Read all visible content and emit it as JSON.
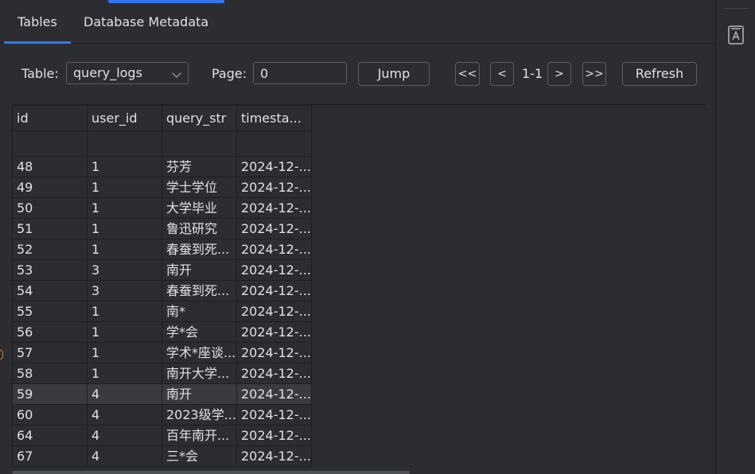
{
  "tabs": [
    {
      "label": "Tables",
      "active": true
    },
    {
      "label": "Database Metadata",
      "active": false
    }
  ],
  "toolbar": {
    "table_label": "Table:",
    "table_value": "query_logs",
    "page_label": "Page:",
    "page_value": "0",
    "jump_label": "Jump",
    "first_label": "<<",
    "prev_label": "<",
    "page_range": "1-1",
    "next_label": ">",
    "last_label": ">>",
    "refresh_label": "Refresh"
  },
  "table": {
    "columns": [
      "id",
      "user_id",
      "query_str",
      "timesta..."
    ],
    "rows": [
      [
        "48",
        "1",
        "芬芳",
        "2024-12-..."
      ],
      [
        "49",
        "1",
        "学士学位",
        "2024-12-..."
      ],
      [
        "50",
        "1",
        "大学毕业",
        "2024-12-..."
      ],
      [
        "51",
        "1",
        "鲁迅研究",
        "2024-12-..."
      ],
      [
        "52",
        "1",
        "春蚕到死...",
        "2024-12-..."
      ],
      [
        "53",
        "3",
        "南开",
        "2024-12-..."
      ],
      [
        "54",
        "3",
        "春蚕到死...",
        "2024-12-..."
      ],
      [
        "55",
        "1",
        "南*",
        "2024-12-..."
      ],
      [
        "56",
        "1",
        "学*会",
        "2024-12-..."
      ],
      [
        "57",
        "1",
        "学术*座谈...",
        "2024-12-..."
      ],
      [
        "58",
        "1",
        "南开大学...",
        "2024-12-..."
      ],
      [
        "59",
        "4",
        "南开",
        "2024-12-..."
      ],
      [
        "60",
        "4",
        "2023级学...",
        "2024-12-..."
      ],
      [
        "64",
        "4",
        "百年南开...",
        "2024-12-..."
      ],
      [
        "67",
        "4",
        "三*会",
        "2024-12-..."
      ]
    ],
    "selected_row": 11
  },
  "icons": {
    "right_strip": "book-icon"
  },
  "colors": {
    "background": "#2b2d30",
    "accent": "#3574f0",
    "border": "#1e1f22",
    "selected_row": "#393b40"
  }
}
